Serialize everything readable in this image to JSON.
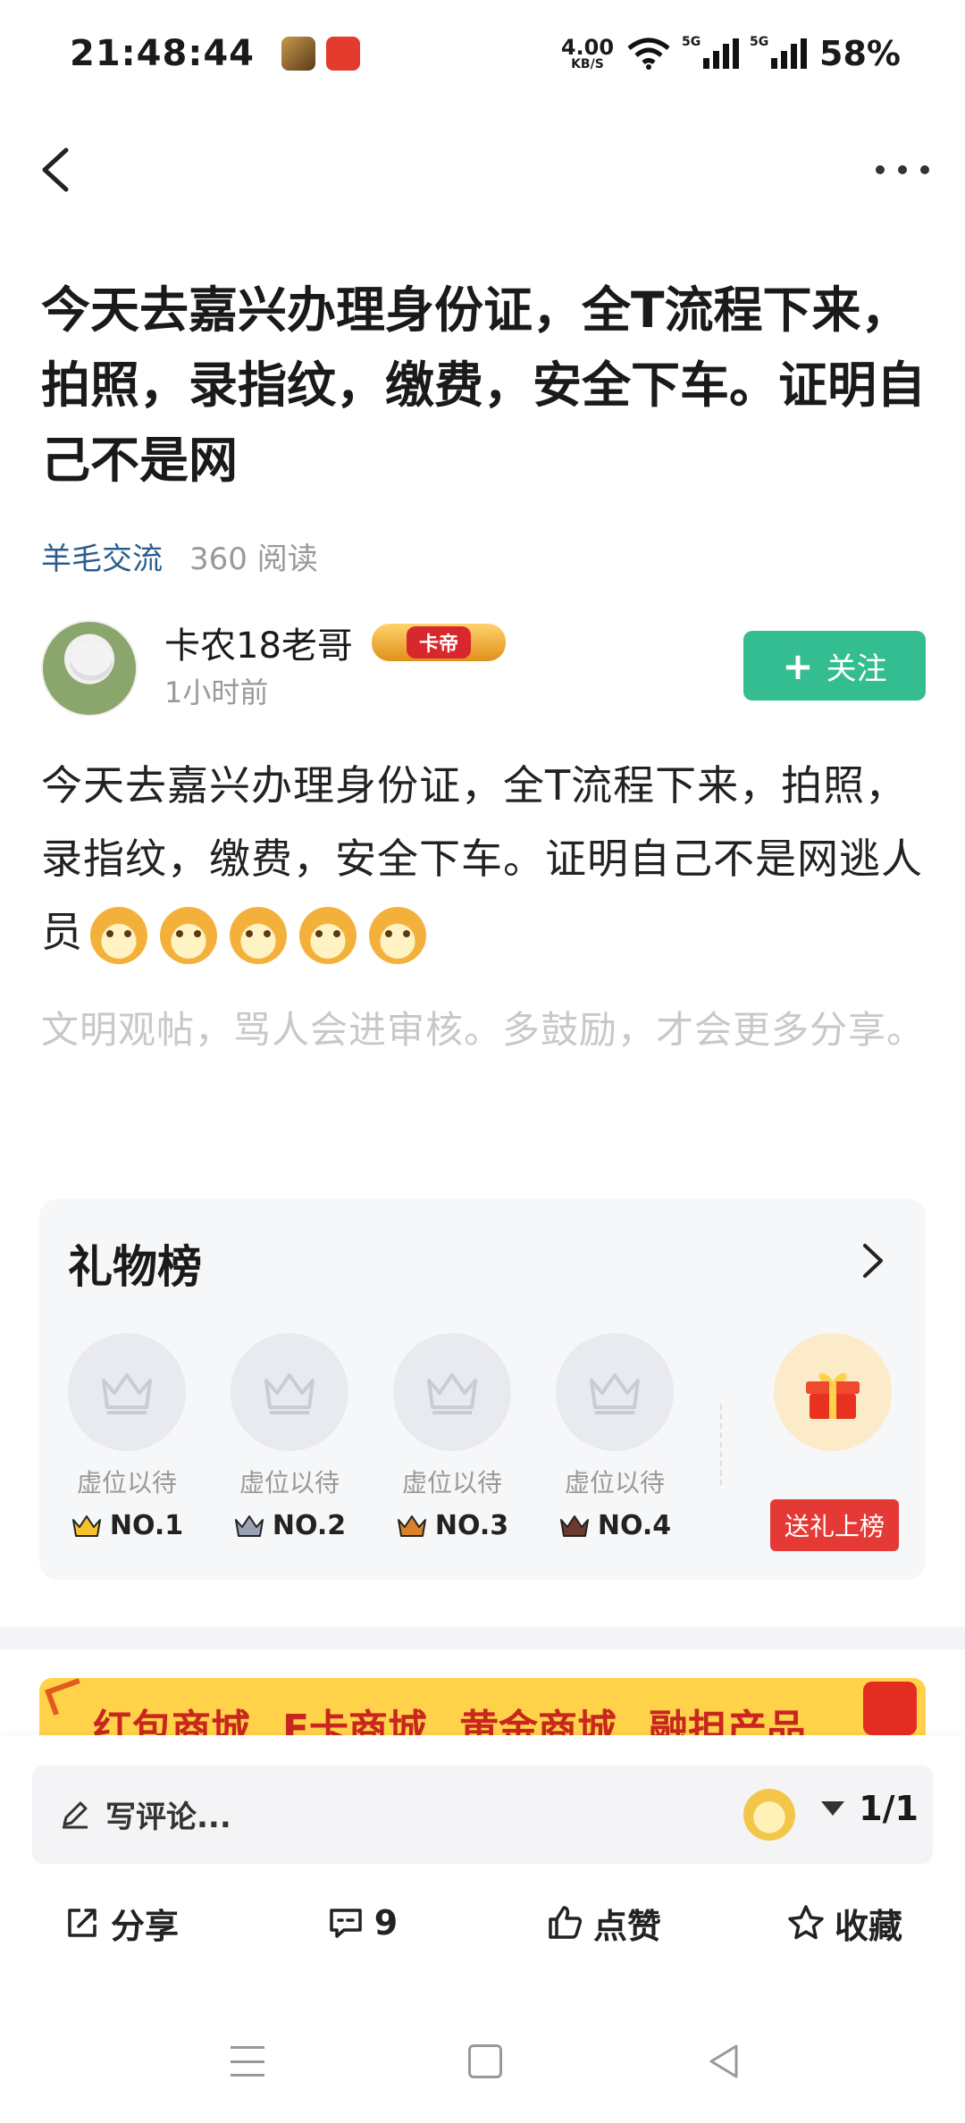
{
  "status_bar": {
    "time": "21:48:44",
    "net_speed_value": "4.00",
    "net_speed_unit": "KB/S",
    "sim1": "5G",
    "sim2": "5G",
    "battery": "58%"
  },
  "post": {
    "title": "今天去嘉兴办理身份证，全T流程下来，拍照，录指纹，缴费，安全下车。证明自己不是网",
    "category": "羊毛交流",
    "reads": "360 阅读",
    "author": {
      "name": "卡农18老哥",
      "badge": "卡帝",
      "time": "1小时前"
    },
    "follow_label": "关注",
    "body": "今天去嘉兴办理身份证，全T流程下来，拍照，录指纹，缴费，安全下车。证明自己不是网逃人员",
    "emoji_count": 5,
    "hint": "文明观帖，骂人会进审核。多鼓励，才会更多分享。"
  },
  "gift_board": {
    "title": "礼物榜",
    "slots": [
      {
        "text": "虚位以待",
        "rank": "NO.1",
        "crown_color": "#f5c22b"
      },
      {
        "text": "虚位以待",
        "rank": "NO.2",
        "crown_color": "#9aa3b5"
      },
      {
        "text": "虚位以待",
        "rank": "NO.3",
        "crown_color": "#d9822b"
      },
      {
        "text": "虚位以待",
        "rank": "NO.4",
        "crown_color": "#6b3b2e"
      }
    ],
    "send_label": "送礼上榜"
  },
  "banner": {
    "items": [
      "红包商城",
      "E卡商城",
      "黄金商城",
      "融担产品"
    ]
  },
  "comment_bar": {
    "placeholder": "写评论...",
    "page_indicator": "1/1"
  },
  "actions": {
    "share": "分享",
    "comments": "9",
    "like": "点赞",
    "favorite": "收藏"
  },
  "colors": {
    "accent": "#33bd91",
    "category": "#2b5d8c",
    "danger": "#e53935"
  }
}
